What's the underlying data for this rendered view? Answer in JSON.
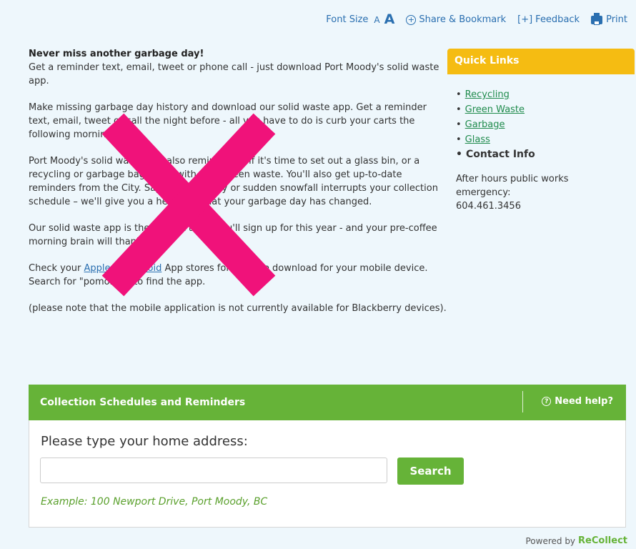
{
  "toolbar": {
    "font_size_label": "Font Size",
    "font_small": "A",
    "font_large": "A",
    "share_label": "Share & Bookmark",
    "share_icon": "+",
    "feedback_label": "Feedback",
    "feedback_icon": "[+]",
    "print_label": "Print"
  },
  "main": {
    "heading": "Never miss another garbage day!",
    "intro": "Get a reminder text, email, tweet or phone call - just download Port Moody's solid waste app.",
    "para1": "Make missing garbage day history and download our solid waste app. Get a reminder text, email, tweet or call the night before - all you have to do is curb your carts the following morning.",
    "para2": "Port Moody's solid waste app also reminds you if it's time to set out a glass bin, or a recycling or garbage bag along with your green waste. You'll also get up-to-date reminders from the City. Say a stat holiday or sudden snowfall interrupts your collection schedule – we'll give you a heads-up that your garbage day has changed.",
    "para3": "Our solid waste app is the easiest thing you'll sign up for this year - and your pre-coffee morning brain will thank you.",
    "para4_pre": "Check your ",
    "para4_link1": "Apple",
    "para4_mid": " or ",
    "para4_link2": "Android",
    "para4_post": " App stores for the free download for your mobile device. Search for \"pomobile\" to find the app.",
    "para5": "(please note that the mobile application is not currently available for Blackberry devices)."
  },
  "sidebar": {
    "title": "Quick Links",
    "links": [
      {
        "label": "Recycling"
      },
      {
        "label": "Green Waste"
      },
      {
        "label": "Garbage"
      },
      {
        "label": "Glass"
      }
    ],
    "contact_label": "Contact Info",
    "after_hours": "After hours public works emergency:",
    "phone": "604.461.3456",
    "accent": "#f5bc12"
  },
  "widget": {
    "title": "Collection Schedules and Reminders",
    "help_label": "Need help?",
    "prompt": "Please type your home address:",
    "input_value": "",
    "search_label": "Search",
    "example": "Example: 100 Newport Drive, Port Moody, BC",
    "accent": "#66b338"
  },
  "footer": {
    "powered_by": "Powered by",
    "brand": "ReCollect"
  },
  "overlay": {
    "icon": "x-mark-icon",
    "color": "#f0127a"
  }
}
